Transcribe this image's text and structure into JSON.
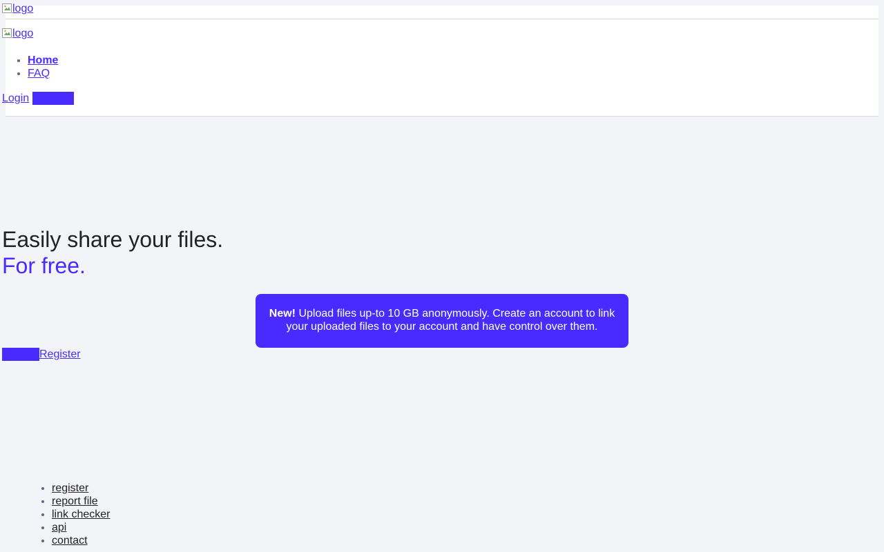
{
  "top_bar": {
    "logo_alt": "logo"
  },
  "header": {
    "logo_alt": "logo",
    "nav": [
      {
        "label": "Home",
        "active": true
      },
      {
        "label": "FAQ",
        "active": false
      }
    ],
    "login_label": "Login",
    "signup_button_label": ""
  },
  "hero": {
    "title": "Easily share your files.",
    "subtitle": "For free."
  },
  "notice": {
    "badge": "New!",
    "text": "Upload files up-to 10 GB anonymously. Create an account to link your uploaded files to your account and have control over them."
  },
  "cta": {
    "upload_button_label": "",
    "register_label": "Register"
  },
  "footer": {
    "links": [
      "register",
      "report file",
      "link checker",
      "api",
      "contact"
    ]
  },
  "colors": {
    "accent": "#4a2bff",
    "background": "#f3f4f8",
    "bullet": "#5a6a85"
  }
}
